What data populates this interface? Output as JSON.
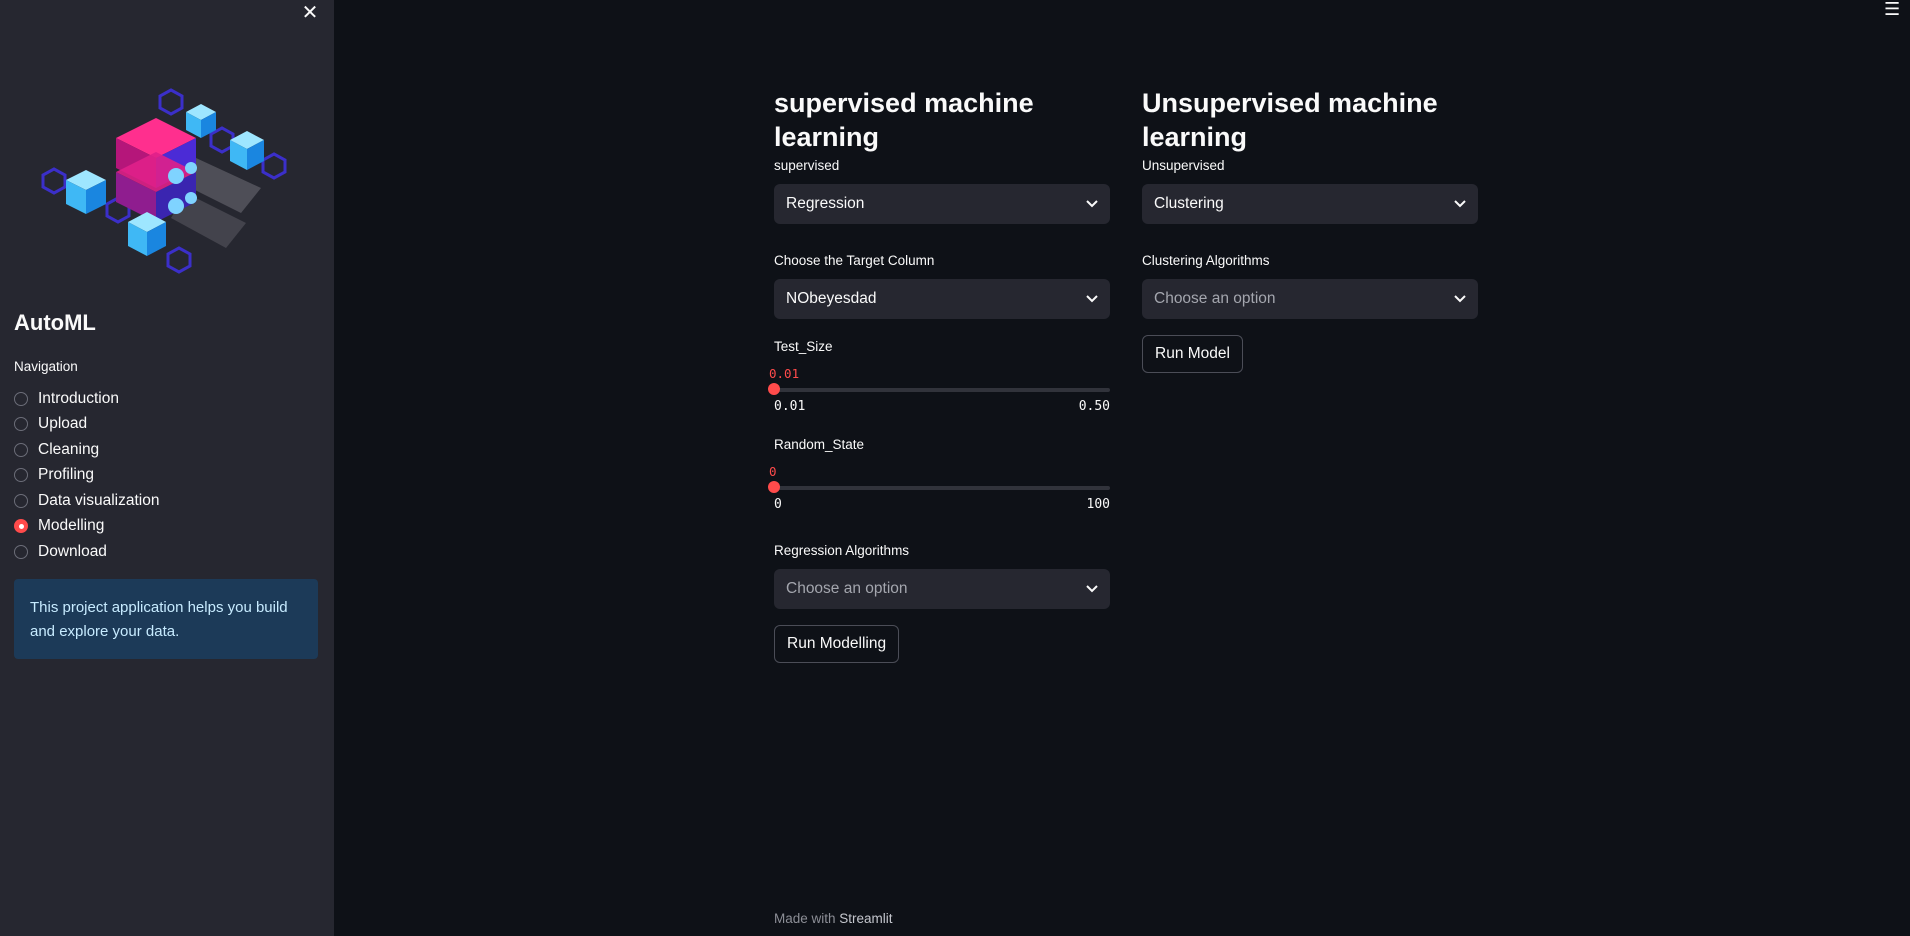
{
  "sidebar": {
    "close_icon": "close-icon",
    "app_title": "AutoML",
    "nav_label": "Navigation",
    "nav_items": [
      {
        "label": "Introduction",
        "selected": false
      },
      {
        "label": "Upload",
        "selected": false
      },
      {
        "label": "Cleaning",
        "selected": false
      },
      {
        "label": "Profiling",
        "selected": false
      },
      {
        "label": "Data visualization",
        "selected": false
      },
      {
        "label": "Modelling",
        "selected": true
      },
      {
        "label": "Download",
        "selected": false
      }
    ],
    "info_text": "This project application helps you build and explore your data."
  },
  "header": {
    "menu_icon": "hamburger-menu-icon"
  },
  "supervised": {
    "title": "supervised machine learning",
    "type_label": "supervised",
    "type_value": "Regression",
    "target_label": "Choose the Target Column",
    "target_value": "NObeyesdad",
    "test_size": {
      "label": "Test_Size",
      "value": "0.01",
      "min": "0.01",
      "max": "0.50"
    },
    "random_state": {
      "label": "Random_State",
      "value": "0",
      "min": "0",
      "max": "100"
    },
    "algo_label": "Regression Algorithms",
    "algo_placeholder": "Choose an option",
    "run_button": "Run Modelling"
  },
  "unsupervised": {
    "title": "Unsupervised machine learning",
    "type_label": "Unsupervised",
    "type_value": "Clustering",
    "algo_label": "Clustering Algorithms",
    "algo_placeholder": "Choose an option",
    "run_button": "Run Model"
  },
  "footer": {
    "prefix": "Made with ",
    "brand": "Streamlit"
  },
  "colors": {
    "accent": "#ff4b4b",
    "sidebar_bg": "#262730",
    "main_bg": "#0e1117",
    "info_bg": "#1c3a58"
  }
}
